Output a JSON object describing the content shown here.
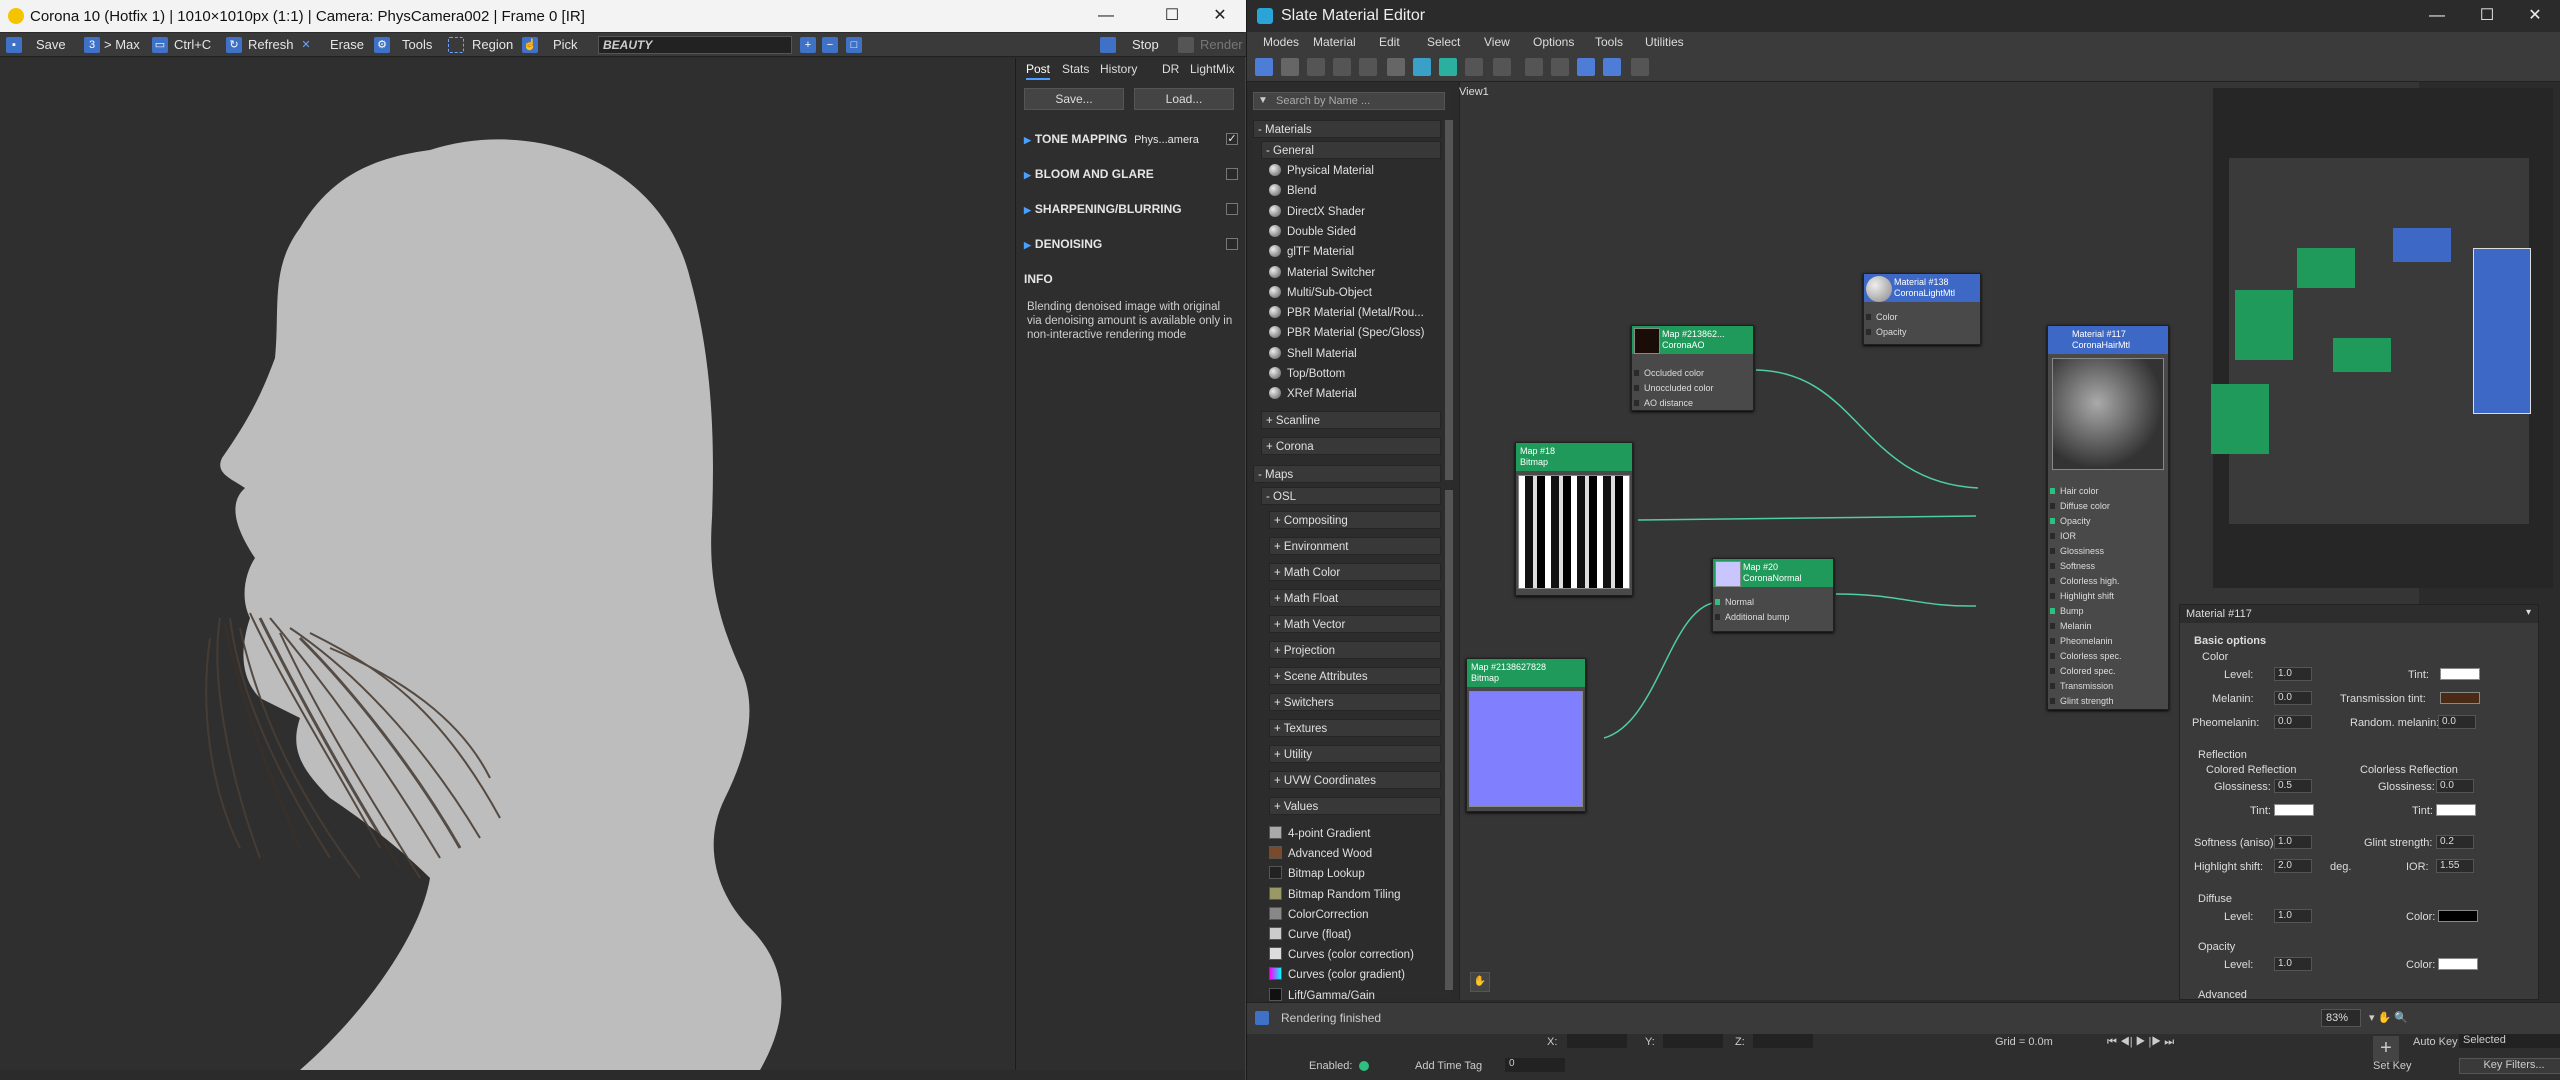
{
  "vfb": {
    "title": "Corona 10 (Hotfix 1) | 1010×1010px (1:1) | Camera: PhysCamera002 | Frame 0 [IR]",
    "toolbar": {
      "save": "Save",
      "max": "> Max",
      "copy": "Ctrl+C",
      "refresh": "Refresh",
      "erase": "Erase",
      "tools": "Tools",
      "region": "Region",
      "pick": "Pick",
      "pass": "BEAUTY",
      "stop": "Stop",
      "render": "Render"
    },
    "tabs": [
      "Post",
      "Stats",
      "History",
      "DR",
      "LightMix"
    ],
    "save_btn": "Save...",
    "load_btn": "Load...",
    "sections": [
      {
        "label": "TONE MAPPING",
        "sub": "Phys...amera",
        "checked": true
      },
      {
        "label": "BLOOM AND GLARE",
        "sub": "",
        "checked": false
      },
      {
        "label": "SHARPENING/BLURRING",
        "sub": "",
        "checked": false
      },
      {
        "label": "DENOISING",
        "sub": "",
        "checked": false
      }
    ],
    "info_title": "INFO",
    "info_text": "Blending denoised image with original via denoising amount is available only in non-interactive rendering mode"
  },
  "slate": {
    "title": "Slate Material Editor",
    "menu": [
      "Modes",
      "Material",
      "Edit",
      "Select",
      "View",
      "Options",
      "Tools",
      "Utilities"
    ],
    "search_placeholder": "Search by Name ...",
    "view_tab": "View1",
    "browser": {
      "materials": "- Materials",
      "general": "- General",
      "general_items": [
        "Physical Material",
        "Blend",
        "DirectX Shader",
        "Double Sided",
        "glTF Material",
        "Material Switcher",
        "Multi/Sub-Object",
        "PBR Material (Metal/Rou...",
        "PBR Material (Spec/Gloss)",
        "Shell Material",
        "Top/Bottom",
        "XRef Material"
      ],
      "scanline": "+ Scanline",
      "corona": "+ Corona",
      "maps": "- Maps",
      "osl": "- OSL",
      "osl_items": [
        "+ Compositing",
        "+ Environment",
        "+ Math Color",
        "+ Math Float",
        "+ Math Vector",
        "+ Projection",
        "+ Scene Attributes",
        "+ Switchers",
        "+ Textures",
        "+ Utility",
        "+ UVW Coordinates",
        "+ Values"
      ],
      "map_items": [
        "4-point Gradient",
        "Advanced Wood",
        "Bitmap Lookup",
        "Bitmap Random Tiling",
        "ColorCorrection",
        "Curve (float)",
        "Curves (color correction)",
        "Curves (color gradient)",
        "Lift/Gamma/Gain"
      ]
    },
    "nodes": {
      "ao": {
        "title": "Map #213862...",
        "sub": "CoronaAO",
        "slots": [
          "Occluded color",
          "Unoccluded color",
          "AO distance"
        ]
      },
      "light": {
        "title": "Material #138",
        "sub": "CoronaLightMtl",
        "slots": [
          "Color",
          "Opacity"
        ]
      },
      "hair": {
        "title": "Material #117",
        "sub": "CoronaHairMtl",
        "slots": [
          "Hair color",
          "Diffuse color",
          "Opacity",
          "IOR",
          "Glossiness",
          "Softness",
          "Colorless high.",
          "Highlight shift",
          "Bump",
          "Melanin",
          "Pheomelanin",
          "Colorless spec.",
          "Colored spec.",
          "Transmission",
          "Glint strength"
        ]
      },
      "bitmap18": {
        "title": "Map #18",
        "sub": "Bitmap"
      },
      "normal": {
        "title": "Map #20",
        "sub": "CoronaNormal",
        "slots": [
          "Normal",
          "Additional bump"
        ]
      },
      "bitmap_n": {
        "title": "Map #2138627828",
        "sub": "Bitmap"
      }
    },
    "params": {
      "header": "Material #117",
      "basic": "Basic options",
      "color": "Color",
      "level_label": "Level:",
      "level": "1.0",
      "tint_label": "Tint:",
      "melanin_label": "Melanin:",
      "melanin": "0.0",
      "trans_tint_label": "Transmission tint:",
      "pheo_label": "Pheomelanin:",
      "pheo": "0.0",
      "rand_label": "Random. melanin:",
      "rand": "0.0",
      "reflection": "Reflection",
      "colored_refl": "Colored Reflection",
      "colorless_refl": "Colorless Reflection",
      "gloss_label": "Glossiness:",
      "gloss1": "0.5",
      "gloss2": "0.0",
      "soft_label": "Softness (aniso):",
      "soft": "1.0",
      "glint_label": "Glint strength:",
      "glint": "0.2",
      "hshift_label": "Highlight shift:",
      "hshift": "2.0",
      "deg": "deg.",
      "ior_label": "IOR:",
      "ior": "1.55",
      "diffuse": "Diffuse",
      "diff_level": "1.0",
      "color_label": "Color:",
      "opacity": "Opacity",
      "op_level": "1.0",
      "advanced": "Advanced"
    },
    "status": "Rendering finished",
    "zoom": "83%",
    "bottom": {
      "x_label": "X:",
      "y_label": "Y:",
      "z_label": "Z:",
      "grid": "Grid = 0.0m",
      "autokey": "Auto Key",
      "selected": "Selected",
      "setkey": "Set Key",
      "keyfilters": "Key Filters...",
      "enabled": "Enabled:",
      "addtime": "Add Time Tag",
      "frame": "0"
    }
  }
}
